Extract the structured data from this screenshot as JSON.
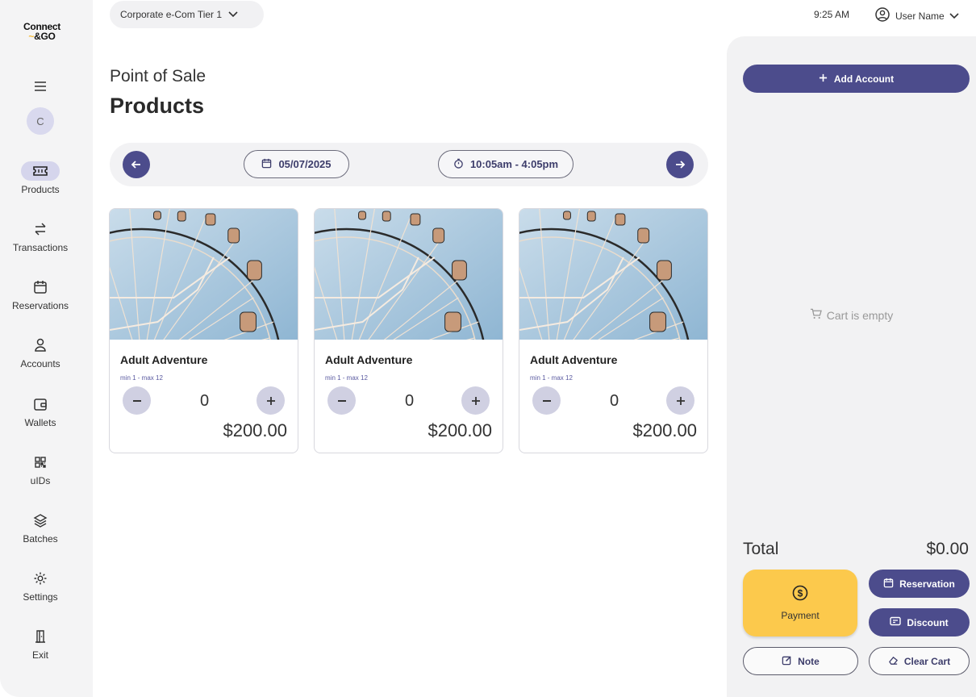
{
  "brand": {
    "line1": "Connect",
    "line2": "&GO",
    "accent": "#f5b82e"
  },
  "sidebar": {
    "avatar_initial": "C",
    "items": [
      {
        "label": "Products",
        "icon": "ticket-icon",
        "active": true
      },
      {
        "label": "Transactions",
        "icon": "arrows-swap-icon"
      },
      {
        "label": "Reservations",
        "icon": "calendar-icon"
      },
      {
        "label": "Accounts",
        "icon": "user-icon"
      },
      {
        "label": "Wallets",
        "icon": "wallet-icon"
      },
      {
        "label": "uIDs",
        "icon": "qr-code-icon"
      },
      {
        "label": "Batches",
        "icon": "layers-icon"
      },
      {
        "label": "Settings",
        "icon": "gear-icon"
      },
      {
        "label": "Exit",
        "icon": "door-exit-icon"
      }
    ]
  },
  "header": {
    "org": "Corporate e-Com Tier 1",
    "time": "9:25 AM",
    "user": "User Name"
  },
  "main": {
    "subtitle": "Point of Sale",
    "title": "Products",
    "date": "05/07/2025",
    "time_range": "10:05am - 4:05pm"
  },
  "products": [
    {
      "name": "Adult Adventure",
      "limits": "min 1 - max 12",
      "qty": "0",
      "price": "$200.00"
    },
    {
      "name": "Adult Adventure",
      "limits": "min 1 - max 12",
      "qty": "0",
      "price": "$200.00"
    },
    {
      "name": "Adult Adventure",
      "limits": "min 1 - max 12",
      "qty": "0",
      "price": "$200.00"
    }
  ],
  "cart": {
    "add_account": "Add Account",
    "empty": "Cart is empty",
    "total_label": "Total",
    "total_value": "$0.00",
    "payment": "Payment",
    "reservation": "Reservation",
    "discount": "Discount",
    "note": "Note",
    "clear": "Clear Cart"
  },
  "colors": {
    "primary": "#4c4c8c",
    "payment": "#fcc94c",
    "panel": "#f2f2f3"
  }
}
